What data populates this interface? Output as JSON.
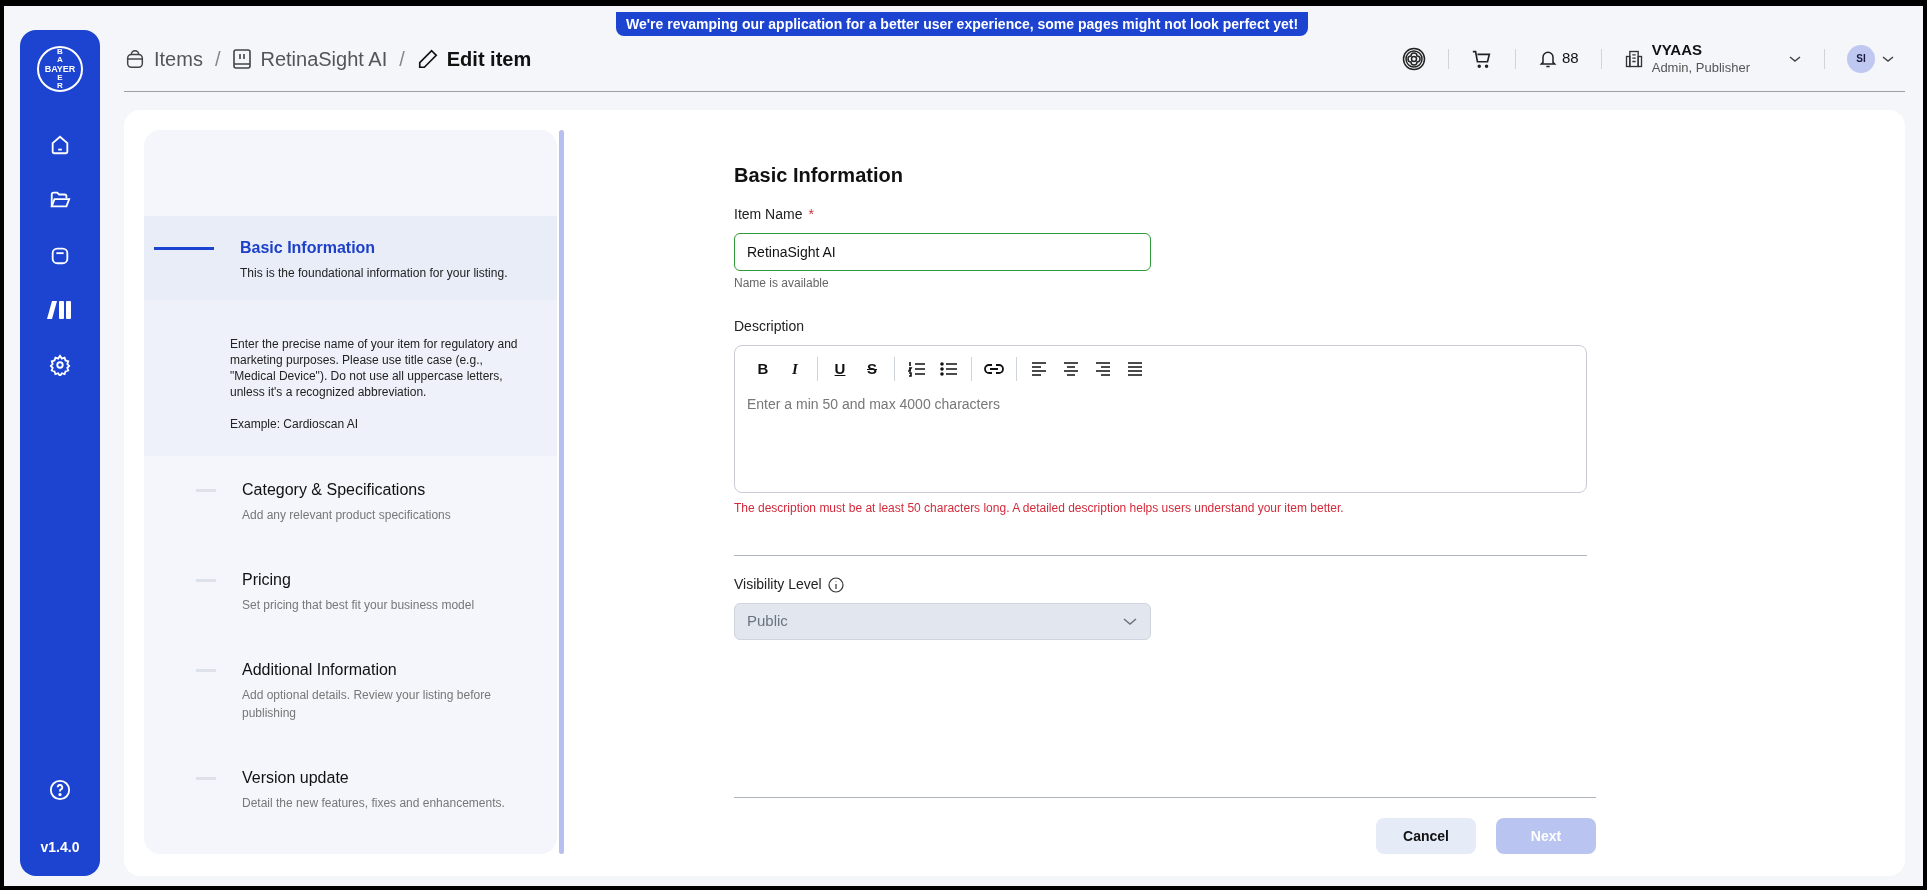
{
  "banner": "We're revamping our application for a better user experience, some pages might not look perfect yet!",
  "breadcrumbs": [
    {
      "kind": "bag",
      "label": "Items",
      "current": false
    },
    {
      "kind": "book",
      "label": "RetinaSight AI",
      "current": false,
      "separator": "/"
    },
    {
      "kind": "pencil",
      "label": "Edit item",
      "current": true,
      "separator": "/"
    }
  ],
  "header": {
    "notifications": "88",
    "org_name": "VYAAS",
    "org_roles": "Admin, Publisher",
    "avatar": "SI"
  },
  "sidebar": {
    "logo_across": "BAYER",
    "logo_down_above": "BA",
    "logo_down_below": "ER",
    "version": "v1.4.0"
  },
  "steps": [
    {
      "title": "Basic Information",
      "description": "This is the foundational information for your listing.",
      "selected": true,
      "hint": [
        "Enter the precise name of your item for regulatory and marketing purposes. Please use title case (e.g., \"Medical Device\"). Do not use all uppercase letters, unless it's a recognized abbreviation.",
        "Example: Cardioscan AI"
      ]
    },
    {
      "title": "Category & Specifications",
      "description": "Add any relevant product specifications",
      "selected": false
    },
    {
      "title": "Pricing",
      "description": "Set pricing that best fit your business model",
      "selected": false
    },
    {
      "title": "Additional Information",
      "description": "Add optional details. Review your listing before publishing",
      "selected": false
    },
    {
      "title": "Version update",
      "description": "Detail the new features, fixes and enhancements.",
      "selected": false
    }
  ],
  "form": {
    "title": "Basic Information",
    "item_name": {
      "label": "Item Name",
      "required_mark": "*",
      "value": "RetinaSight AI",
      "valid": true,
      "helper": "Name is available"
    },
    "description": {
      "label": "Description",
      "placeholder": "Enter a min 50 and max 4000 characters",
      "error": "The description must be at least 50 characters long. A detailed description helps users understand your item better.",
      "toolbar": [
        [
          {
            "kind": "bold",
            "label": "B"
          },
          {
            "kind": "italic",
            "label": "I"
          }
        ],
        [
          {
            "kind": "underline",
            "label": "U"
          },
          {
            "kind": "strike",
            "label": "S"
          }
        ],
        [
          {
            "kind": "ordered-list"
          },
          {
            "kind": "bullet-list"
          }
        ],
        [
          {
            "kind": "link"
          }
        ],
        [
          {
            "kind": "align-left"
          },
          {
            "kind": "align-center"
          },
          {
            "kind": "align-right"
          },
          {
            "kind": "justify"
          }
        ]
      ]
    },
    "visibility": {
      "label": "Visibility Level",
      "value": "Public",
      "disabled": true
    }
  },
  "buttons": [
    {
      "kind": "secondary",
      "label": "Cancel",
      "disabled": false
    },
    {
      "kind": "primary",
      "label": "Next",
      "disabled": true
    }
  ]
}
